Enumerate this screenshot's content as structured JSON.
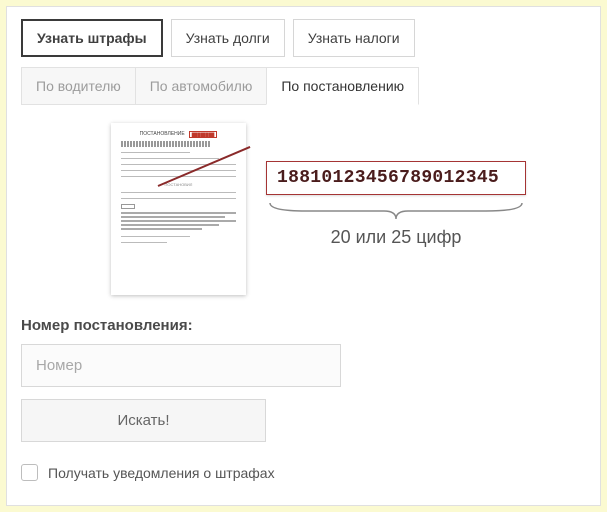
{
  "top_tabs": {
    "fines": "Узнать штрафы",
    "debts": "Узнать долги",
    "taxes": "Узнать налоги"
  },
  "sub_tabs": {
    "by_driver": "По водителю",
    "by_car": "По автомобилю",
    "by_order": "По постановлению"
  },
  "example": {
    "number": "18810123456789012345",
    "caption": "20 или 25 цифр"
  },
  "form": {
    "label": "Номер постановления:",
    "placeholder": "Номер",
    "button": "Искать!",
    "checkbox_label": "Получать уведомления о штрафах"
  }
}
